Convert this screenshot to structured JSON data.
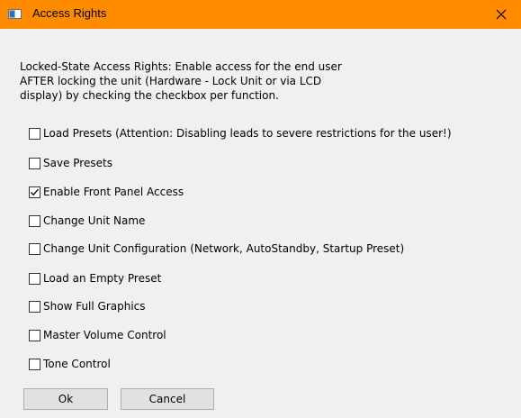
{
  "window": {
    "title": "Access Rights",
    "accent_color": "#ff8c00",
    "icon": "window-app-icon",
    "close_icon": "close-icon"
  },
  "description": {
    "line1": "Locked-State Access Rights: Enable access for the end user",
    "line2": "AFTER locking the unit (Hardware - Lock Unit or via LCD",
    "line3": "display) by checking the checkbox per function."
  },
  "options": [
    {
      "label": "Load Presets (Attention: Disabling leads to severe restrictions for the user!)",
      "checked": false
    },
    {
      "label": "Save Presets",
      "checked": false
    },
    {
      "label": "Enable Front Panel Access",
      "checked": true
    },
    {
      "label": "Change Unit Name",
      "checked": false
    },
    {
      "label": "Change Unit Configuration (Network, AutoStandby, Startup Preset)",
      "checked": false
    },
    {
      "label": "Load an Empty Preset",
      "checked": false
    },
    {
      "label": "Show Full Graphics",
      "checked": false
    },
    {
      "label": "Master Volume Control",
      "checked": false
    },
    {
      "label": "Tone Control",
      "checked": false
    }
  ],
  "buttons": {
    "ok_label": "Ok",
    "cancel_label": "Cancel"
  }
}
